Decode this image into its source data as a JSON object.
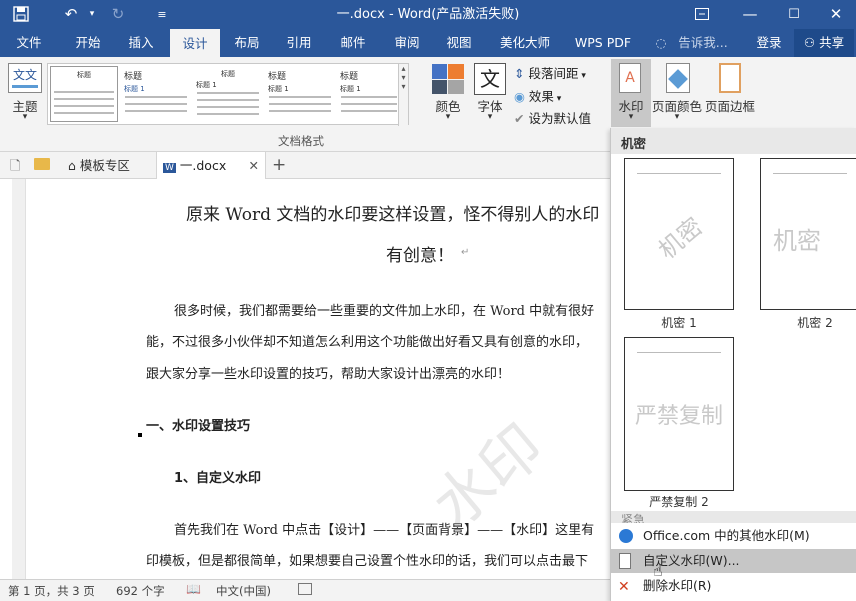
{
  "titlebar": {
    "title": "一.docx - Word(产品激活失败)"
  },
  "tabs": [
    {
      "label": "文件"
    },
    {
      "label": "开始"
    },
    {
      "label": "插入"
    },
    {
      "label": "设计"
    },
    {
      "label": "布局"
    },
    {
      "label": "引用"
    },
    {
      "label": "邮件"
    },
    {
      "label": "审阅"
    },
    {
      "label": "视图"
    },
    {
      "label": "美化大师"
    },
    {
      "label": "WPS PDF"
    }
  ],
  "tellme": "告诉我...",
  "login": "登录",
  "share": "共享",
  "ribbon": {
    "theme": "主题",
    "gallery_title": "标题",
    "gallery_heading1": "标题 1",
    "group_label": "文档格式",
    "colors": "颜色",
    "fonts": "字体",
    "para_spacing": "段落间距",
    "effects": "效果",
    "set_default": "设为默认值",
    "watermark": "水印",
    "page_color": "页面颜色",
    "page_border": "页面边框"
  },
  "filetabs": {
    "template": "模板专区",
    "doc": "一.docx"
  },
  "doc": {
    "title1": "原来 Word 文档的水印要这样设置，怪不得别人的水印",
    "title2": "有创意！",
    "p1a": "很多时候，我们都需要给一些重要的文件加上水印，在 Word 中就有很好",
    "p1b": "能，不过很多小伙伴却不知道怎么利用这个功能做出好看又具有创意的水印，",
    "p1c": "跟大家分享一些水印设置的技巧，帮助大家设计出漂亮的水印！",
    "h1": "一、水印设置技巧",
    "h2": "1、自定义水印",
    "p2a": "首先我们在 Word 中点击【设计】——【页面背景】——【水印】这里有",
    "p2b": "印模板，但是都很简单，如果想要自己设置个性水印的话，我们可以点击最下",
    "bg_watermark": "水印"
  },
  "watermark_panel": {
    "section": "机密",
    "items": [
      {
        "caption": "机密 1",
        "text": "机密"
      },
      {
        "caption": "机密 2",
        "text": "机密"
      },
      {
        "caption": "严禁复制 2",
        "text": "严禁复制"
      }
    ],
    "section2": "紧急",
    "menu": [
      {
        "label": "Office.com 中的其他水印(M)"
      },
      {
        "label": "自定义水印(W)..."
      },
      {
        "label": "删除水印(R)"
      }
    ]
  },
  "status": {
    "page": "第 1 页，共 3 页",
    "words": "692 个字",
    "lang": "中文(中国)"
  },
  "colors": {
    "accent": "#2b579a"
  }
}
